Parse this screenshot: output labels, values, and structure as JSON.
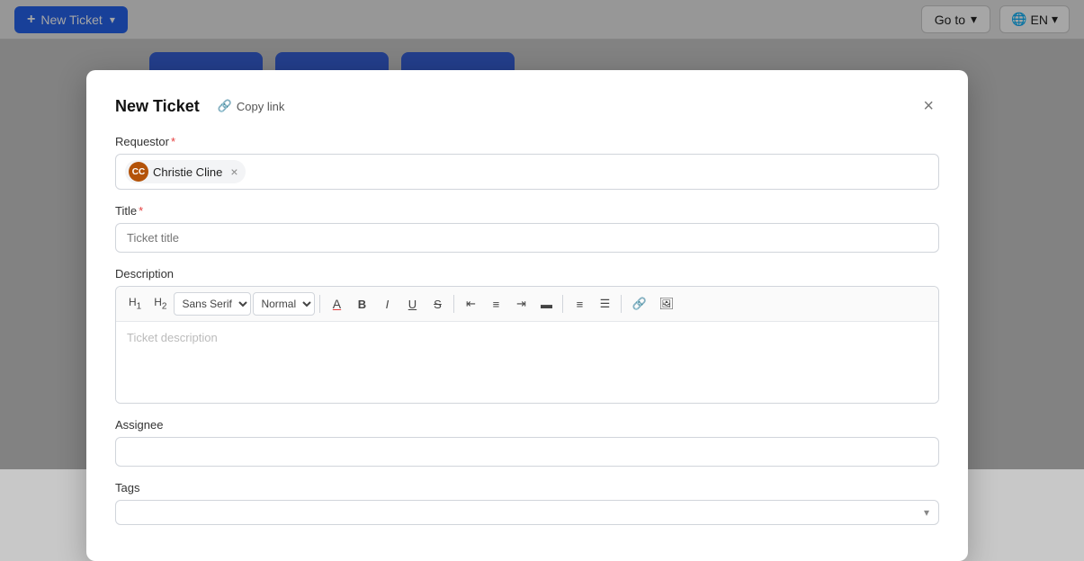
{
  "topbar": {
    "new_ticket_label": "New Ticket",
    "goto_label": "Go to",
    "lang_label": "EN"
  },
  "modal": {
    "title": "New Ticket",
    "copy_link_label": "Copy link",
    "close_label": "×",
    "requestor": {
      "label": "Requestor",
      "required": "*",
      "user_name": "Christie Cline",
      "user_initials": "CC"
    },
    "title_field": {
      "label": "Title",
      "required": "*",
      "placeholder": "Ticket title"
    },
    "description": {
      "label": "Description",
      "placeholder": "Ticket description",
      "toolbar": {
        "h1": "H₁",
        "h2": "H₂",
        "font_family": "Sans Serif",
        "font_size": "Normal",
        "bold": "B",
        "italic": "I",
        "underline": "U",
        "strikethrough": "S",
        "align_left": "≡",
        "align_center": "≡",
        "align_right": "≡",
        "align_justify": "≡",
        "ordered_list": "ol",
        "unordered_list": "ul",
        "link": "🔗",
        "image": "🖼"
      }
    },
    "assignee": {
      "label": "Assignee",
      "placeholder": ""
    },
    "tags": {
      "label": "Tags",
      "placeholder": ""
    }
  }
}
